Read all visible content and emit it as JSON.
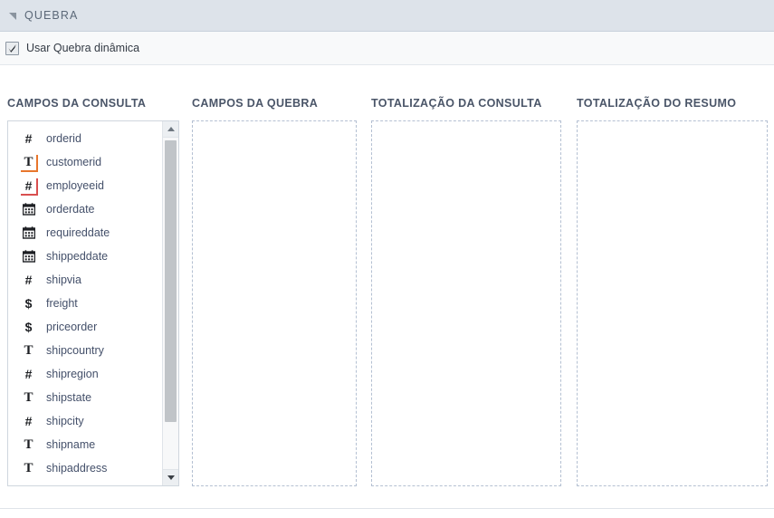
{
  "panel": {
    "title": "QUEBRA",
    "collapse_icon": "collapse-triangle-icon"
  },
  "options": {
    "dynamic_break_label": "Usar Quebra dinâmica",
    "dynamic_break_checked": true,
    "check_icon": "checkmark-icon"
  },
  "columns": [
    {
      "id": "query-fields",
      "title": "CAMPOS DA CONSULTA"
    },
    {
      "id": "break-fields",
      "title": "CAMPOS DA QUEBRA"
    },
    {
      "id": "query-totalization",
      "title": "TOTALIZAÇÃO DA CONSULTA"
    },
    {
      "id": "summary-totalization",
      "title": "TOTALIZAÇÃO DO RESUMO"
    }
  ],
  "query_fields": [
    {
      "label": "orderid",
      "type": "number",
      "icon": "hash-icon",
      "key": false
    },
    {
      "label": "customerid",
      "type": "text",
      "icon": "text-icon",
      "key": true
    },
    {
      "label": "employeeid",
      "type": "number",
      "icon": "hash-icon",
      "key": true
    },
    {
      "label": "orderdate",
      "type": "date",
      "icon": "calendar-icon",
      "key": false
    },
    {
      "label": "requireddate",
      "type": "date",
      "icon": "calendar-icon",
      "key": false
    },
    {
      "label": "shippeddate",
      "type": "date",
      "icon": "calendar-icon",
      "key": false
    },
    {
      "label": "shipvia",
      "type": "number",
      "icon": "hash-icon",
      "key": false
    },
    {
      "label": "freight",
      "type": "currency",
      "icon": "dollar-icon",
      "key": false
    },
    {
      "label": "priceorder",
      "type": "currency",
      "icon": "dollar-icon",
      "key": false
    },
    {
      "label": "shipcountry",
      "type": "text",
      "icon": "text-icon",
      "key": false
    },
    {
      "label": "shipregion",
      "type": "number",
      "icon": "hash-icon",
      "key": false
    },
    {
      "label": "shipstate",
      "type": "text",
      "icon": "text-icon",
      "key": false
    },
    {
      "label": "shipcity",
      "type": "number",
      "icon": "hash-icon",
      "key": false
    },
    {
      "label": "shipname",
      "type": "text",
      "icon": "text-icon",
      "key": false
    },
    {
      "label": "shipaddress",
      "type": "text",
      "icon": "text-icon",
      "key": false
    }
  ],
  "dropzones": {
    "break_fields_items": [],
    "query_totalization_items": [],
    "summary_totalization_items": []
  },
  "scrollbar": {
    "up_icon": "scroll-up-arrow-icon",
    "down_icon": "scroll-down-arrow-icon"
  },
  "colors": {
    "header_bg": "#dde3ea",
    "key_marker": "#e8762c",
    "dashed_border": "#b4c0d2",
    "field_text": "#44506a"
  }
}
